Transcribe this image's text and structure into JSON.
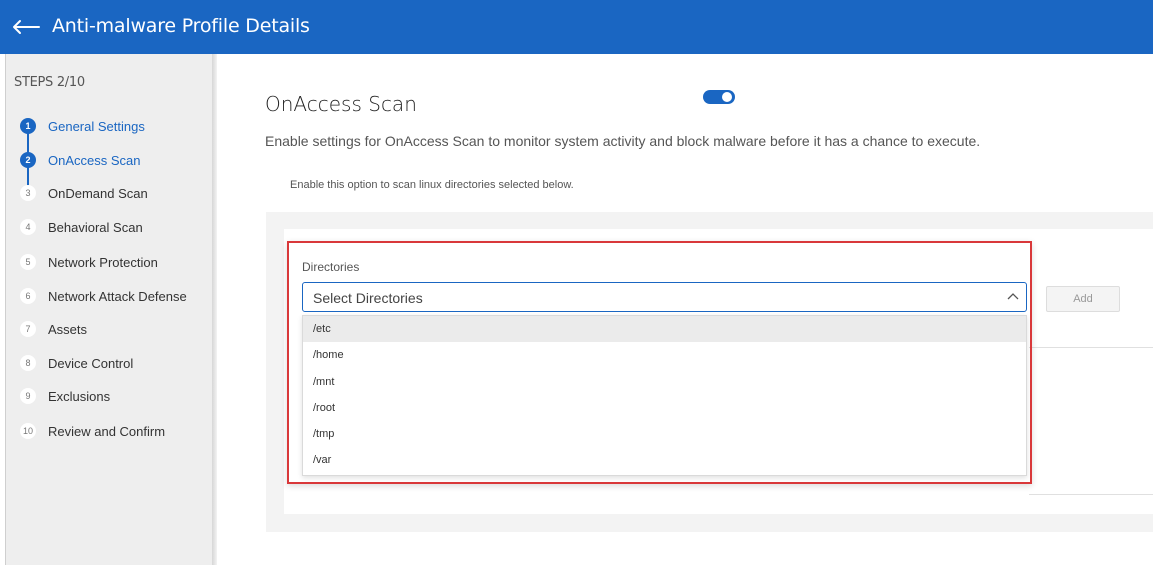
{
  "header": {
    "title": "Anti-malware Profile Details"
  },
  "sidebar": {
    "steps_label": "STEPS 2/10",
    "items": [
      {
        "num": "1",
        "label": "General Settings"
      },
      {
        "num": "2",
        "label": "OnAccess Scan"
      },
      {
        "num": "3",
        "label": "OnDemand Scan"
      },
      {
        "num": "4",
        "label": "Behavioral Scan"
      },
      {
        "num": "5",
        "label": "Network Protection"
      },
      {
        "num": "6",
        "label": "Network Attack Defense"
      },
      {
        "num": "7",
        "label": "Assets"
      },
      {
        "num": "8",
        "label": "Device Control"
      },
      {
        "num": "9",
        "label": "Exclusions"
      },
      {
        "num": "10",
        "label": "Review and Confirm"
      }
    ],
    "completed_step": 1,
    "active_step": 2
  },
  "main": {
    "title": "OnAccess Scan",
    "toggle_on": true,
    "description": "Enable settings for OnAccess Scan to monitor system activity and block malware before it has a chance to execute.",
    "sub_description": "Enable this option to scan linux directories selected below."
  },
  "directories": {
    "label": "Directories",
    "placeholder": "Select Directories",
    "add_label": "Add",
    "options": [
      "/etc",
      "/home",
      "/mnt",
      "/root",
      "/tmp",
      "/var"
    ]
  },
  "colors": {
    "brand": "#1a66c2",
    "highlight": "#d9383a"
  }
}
